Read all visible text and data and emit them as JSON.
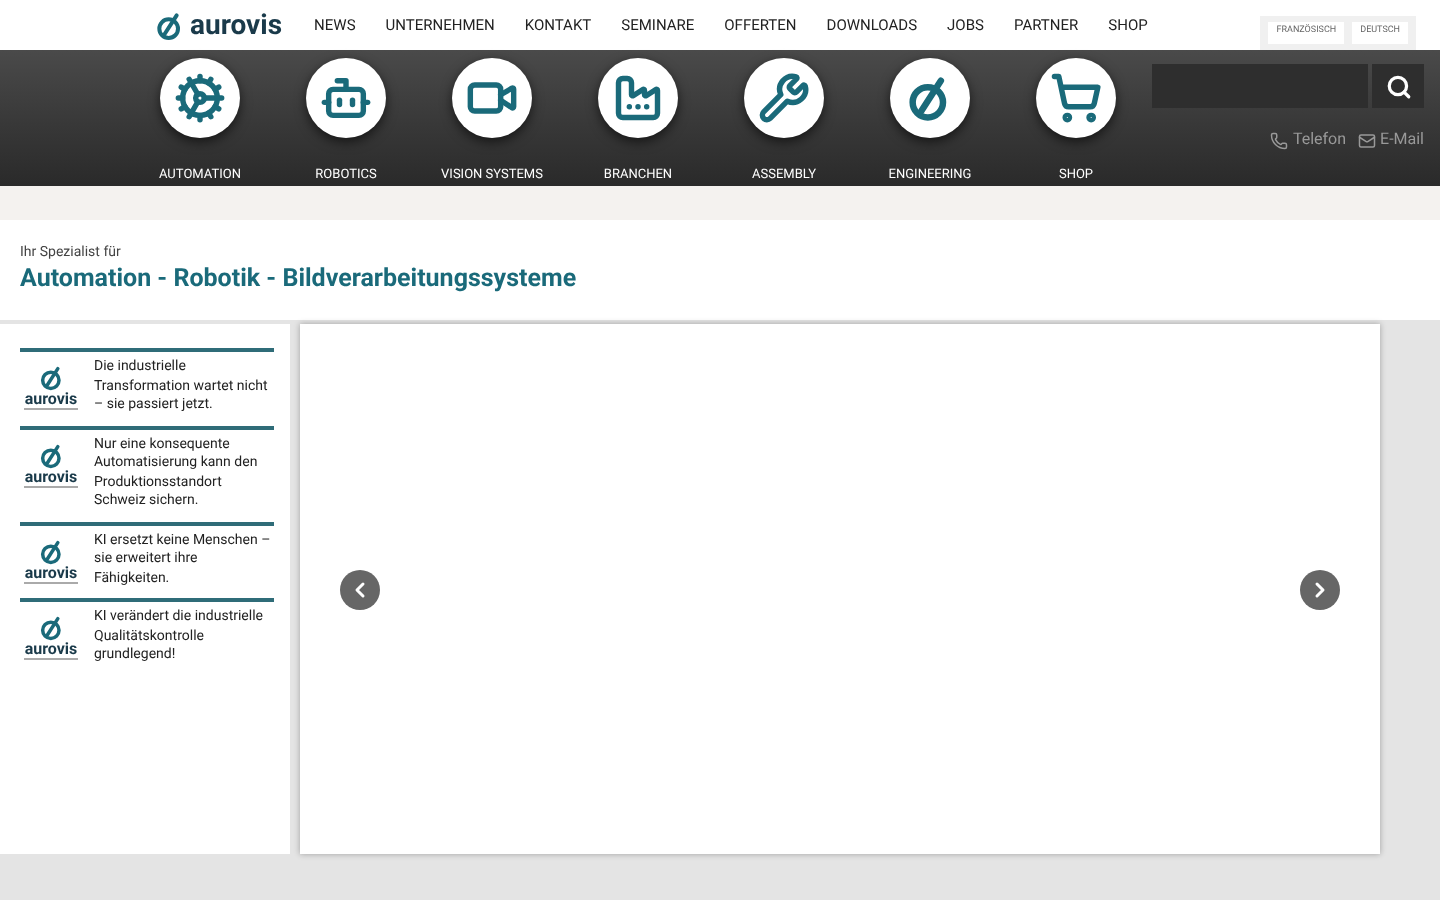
{
  "logo": "aurovis",
  "nav": [
    "NEWS",
    "UNTERNEHMEN",
    "KONTAKT",
    "SEMINARE",
    "OFFERTEN",
    "DOWNLOADS",
    "JOBS",
    "PARTNER",
    "SHOP"
  ],
  "languages": [
    "FRANZÖSISCH",
    "DEUTSCH"
  ],
  "categories": [
    {
      "kind": "gears",
      "label": "AUTOMATION"
    },
    {
      "kind": "robot",
      "label": "ROBOTICS"
    },
    {
      "kind": "camera",
      "label": "VISION SYSTEMS"
    },
    {
      "kind": "factory",
      "label": "BRANCHEN"
    },
    {
      "kind": "tools",
      "label": "ASSEMBLY"
    },
    {
      "kind": "logo",
      "label": "ENGINEERING"
    },
    {
      "kind": "cart",
      "label": "SHOP"
    }
  ],
  "contact": [
    {
      "kind": "phone",
      "label": "Telefon"
    },
    {
      "kind": "mail",
      "label": "E-Mail"
    }
  ],
  "subtitle": "Ihr Spezialist für",
  "headline": "Automation - Robotik - Bildverarbeitungssysteme",
  "news": [
    {
      "logo": "aurovis",
      "text": "Die industrielle Transformation wartet nicht – sie passiert jetzt."
    },
    {
      "logo": "aurovis",
      "text": "Nur eine konsequente Automatisierung kann den Produktionsstandort Schweiz sichern."
    },
    {
      "logo": "aurovis",
      "text": "KI ersetzt keine Menschen – sie erweitert ihre Fähigkeiten."
    },
    {
      "logo": "aurovis",
      "text": "KI verändert die industrielle Qualitätskontrolle grundlegend!"
    }
  ]
}
